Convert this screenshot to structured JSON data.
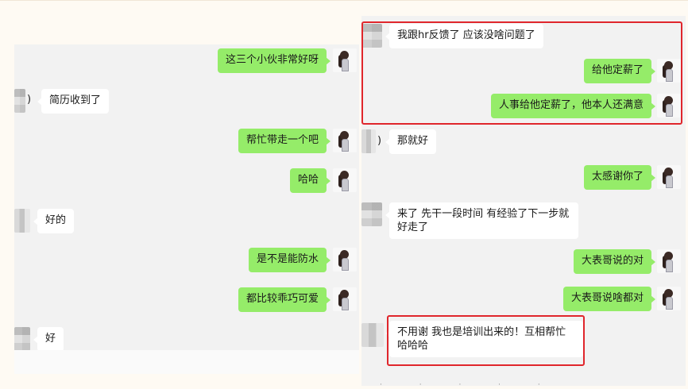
{
  "left_chat": {
    "messages": [
      {
        "side": "me",
        "text": "这三个小伙非常好呀"
      },
      {
        "side": "them",
        "text": "简历收到了",
        "prefix": ")"
      },
      {
        "side": "me",
        "text": "帮忙带走一个吧"
      },
      {
        "side": "me",
        "text": "哈哈"
      },
      {
        "side": "them",
        "text": "好的"
      },
      {
        "side": "me",
        "text": "是不是能防水"
      },
      {
        "side": "me",
        "text": "都比较乖巧可爱"
      },
      {
        "side": "them",
        "text": "好"
      }
    ]
  },
  "right_chat": {
    "messages": [
      {
        "side": "them",
        "text": "我跟hr反馈了 应该没啥问题了"
      },
      {
        "side": "me",
        "text": "给他定薪了"
      },
      {
        "side": "me",
        "text": "人事给他定薪了，他本人还满意"
      },
      {
        "side": "them",
        "text": "那就好",
        "prefix": ")"
      },
      {
        "side": "me",
        "text": "太感谢你了"
      },
      {
        "side": "them",
        "text": "来了 先干一段时间 有经验了下一步就好走了"
      },
      {
        "side": "me",
        "text": "大表哥说的对"
      },
      {
        "side": "me",
        "text": "大表哥说啥都对"
      },
      {
        "side": "them",
        "text": "不用谢 我也是培训出来的！互相帮忙 哈哈哈"
      }
    ]
  },
  "colors": {
    "my_bubble": "#95ec69",
    "their_bubble": "#ffffff",
    "chat_background": "#f2f2f2",
    "highlight": "#e0262c"
  },
  "icons": {
    "my_avatar": "girl-portrait-avatar-icon",
    "their_avatar": "blurred-avatar-icon"
  }
}
